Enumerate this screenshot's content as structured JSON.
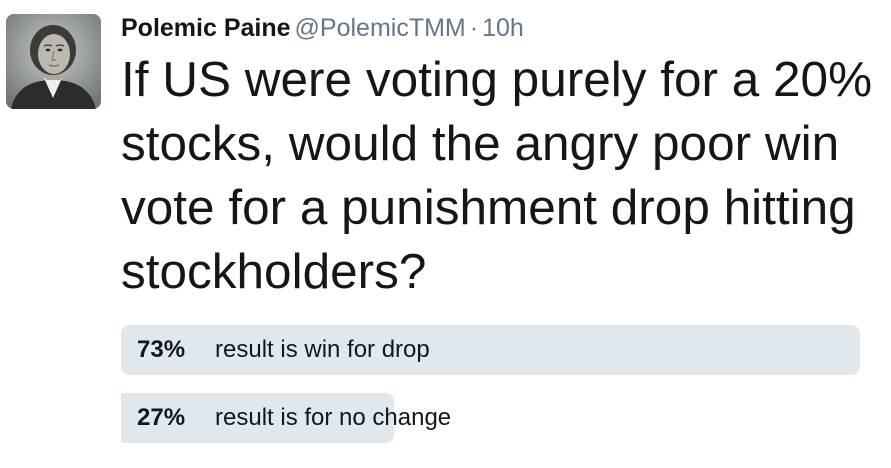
{
  "tweet": {
    "author_name": "Polemic Paine",
    "author_handle": "@PolemicTMM",
    "separator": "·",
    "timestamp": "10h",
    "text_lines": [
      "If US were voting purely for a 20%",
      "stocks, would the angry poor win",
      "vote for a punishment drop hitting",
      "stockholders?"
    ]
  },
  "poll": {
    "options": [
      {
        "percent_label": "73%",
        "label": "result is win for drop",
        "fraction": 0.96
      },
      {
        "percent_label": "27%",
        "label": "result is for no change",
        "fraction": 0.355
      }
    ]
  },
  "colors": {
    "bar": "#e1e8ed",
    "secondary_text": "#657786",
    "primary_text": "#14171a"
  },
  "icons": {
    "avatar": "portrait-avatar"
  }
}
